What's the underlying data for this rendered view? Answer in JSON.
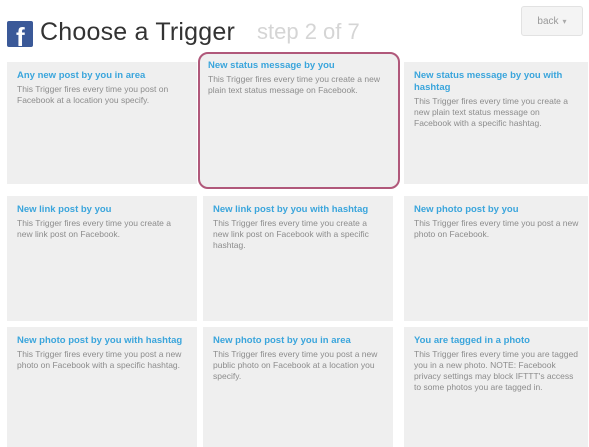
{
  "header": {
    "brand_icon": "facebook-icon",
    "brand_letter": "f",
    "title": "Choose a Trigger",
    "step": "step 2 of 7",
    "back_label": "back",
    "back_chevron": "▾"
  },
  "colors": {
    "facebook_blue": "#3b5998",
    "link_blue": "#3aa5dc",
    "tile_bg": "#efefef",
    "selected_border": "#b0587a"
  },
  "triggers": [
    {
      "title": "Any new post by you in area",
      "description": "This Trigger fires every time you post on Facebook at a location you specify.",
      "selected": false
    },
    {
      "title": "New status message by you",
      "description": "This Trigger fires every time you create a new plain text status message on Facebook.",
      "selected": true
    },
    {
      "title": "New status message by you with hashtag",
      "description": "This Trigger fires every time you create a new plain text status message on Facebook with a specific hashtag.",
      "selected": false
    },
    {
      "title": "New link post by you",
      "description": "This Trigger fires every time you create a new link post on Facebook.",
      "selected": false
    },
    {
      "title": "New link post by you with hashtag",
      "description": "This Trigger fires every time you create a new link post on Facebook with a specific hashtag.",
      "selected": false
    },
    {
      "title": "New photo post by you",
      "description": "This Trigger fires every time you post a new photo on Facebook.",
      "selected": false
    },
    {
      "title": "New photo post by you with hashtag",
      "description": "This Trigger fires every time you post a new photo on Facebook with a specific hashtag.",
      "selected": false
    },
    {
      "title": "New photo post by you in area",
      "description": "This Trigger fires every time you post a new public photo on Facebook at a location you specify.",
      "selected": false
    },
    {
      "title": "You are tagged in a photo",
      "description": "This Trigger fires every time you are tagged you in a new photo. NOTE: Facebook privacy settings may block IFTTT's access to some photos you are tagged in.",
      "selected": false
    }
  ]
}
